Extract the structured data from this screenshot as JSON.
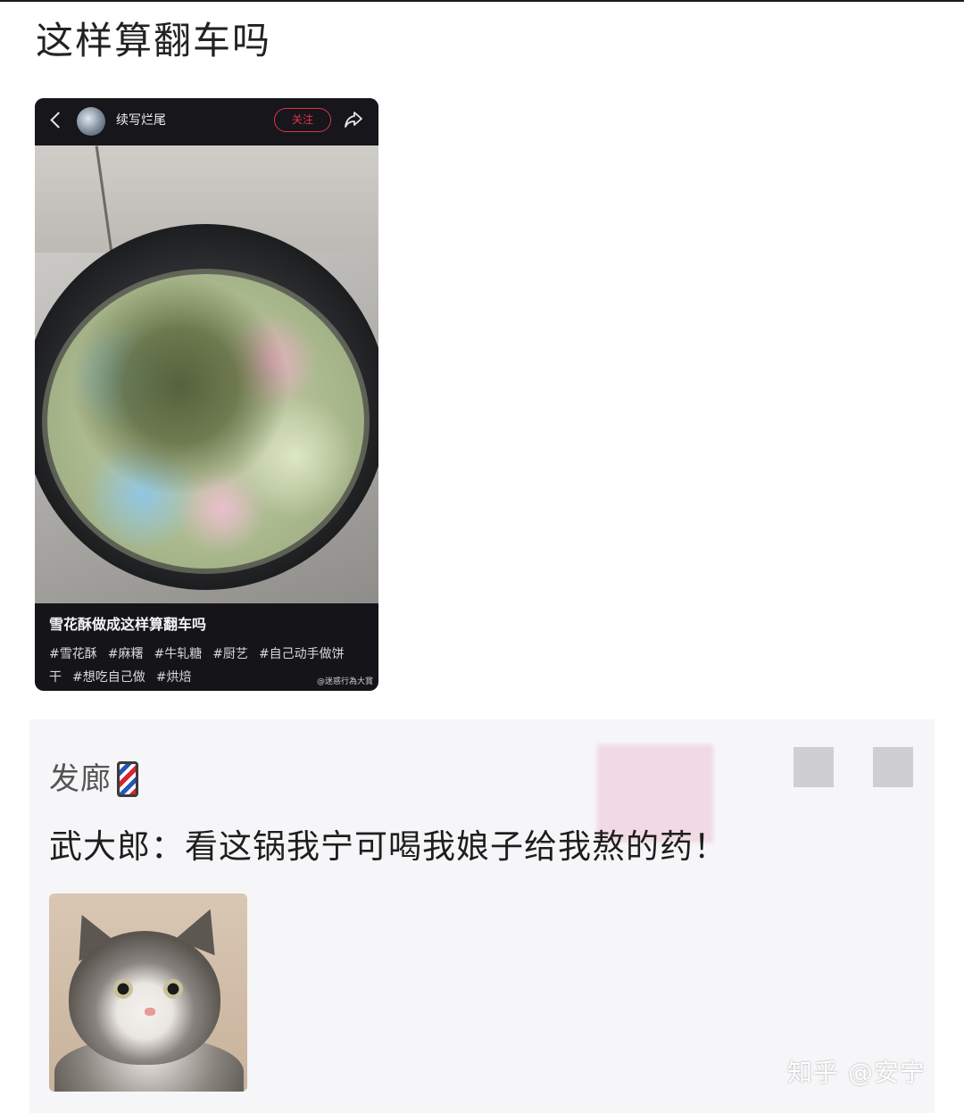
{
  "post": {
    "title": "这样算翻车吗"
  },
  "embedded_screenshot": {
    "username": "续写烂尾",
    "follow_label": "关注",
    "caption_title": "雪花酥做成这样算翻车吗",
    "tags": [
      "#雪花酥",
      "#麻糬",
      "#牛轧糖",
      "#厨艺",
      "#自己动手做饼",
      "干",
      "#想吃自己做",
      "#烘焙"
    ],
    "watermark": "@迷惑行為大賞"
  },
  "comment": {
    "author": "发廊",
    "author_badge_icon": "barber-pole-icon",
    "text": "武大郎：看这锅我宁可喝我娘子给我熬的药！"
  },
  "site_watermark": "知乎 @安宁"
}
